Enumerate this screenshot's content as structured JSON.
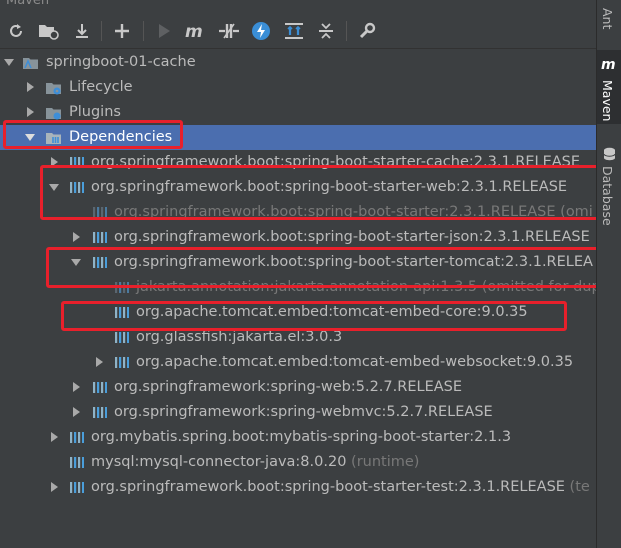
{
  "window": {
    "title": "Maven"
  },
  "toolbar": {
    "buttons": [
      {
        "name": "reload-icon"
      },
      {
        "name": "generate-sources-icon"
      },
      {
        "name": "download-icon"
      },
      {
        "name": "add-icon"
      },
      {
        "name": "run-icon"
      },
      {
        "name": "execute-goal-icon"
      },
      {
        "name": "toggle-offline-icon"
      },
      {
        "name": "skip-tests-icon"
      },
      {
        "name": "show-dependencies-icon"
      },
      {
        "name": "collapse-all-icon"
      },
      {
        "name": "settings-icon"
      }
    ]
  },
  "sidebar": {
    "tabs": [
      {
        "label": "Ant",
        "icon": "ant-icon"
      },
      {
        "label": "Maven",
        "icon": "maven-icon"
      },
      {
        "label": "Database",
        "icon": "database-icon"
      }
    ]
  },
  "tree": {
    "project": "springboot-01-cache",
    "lifecycle": "Lifecycle",
    "plugins": "Plugins",
    "dependencies": "Dependencies",
    "items": [
      {
        "text": "org.springframework.boot:spring-boot-starter-cache:2.3.1.RELEASE",
        "note": ""
      },
      {
        "text": "org.springframework.boot:spring-boot-starter-web:2.3.1.RELEASE",
        "note": ""
      },
      {
        "text": "org.springframework.boot:spring-boot-starter:2.3.1.RELEASE",
        "note": " (omi"
      },
      {
        "text": "org.springframework.boot:spring-boot-starter-json:2.3.1.RELEASE",
        "note": ""
      },
      {
        "text": "org.springframework.boot:spring-boot-starter-tomcat:2.3.1.RELEA",
        "note": ""
      },
      {
        "text": "jakarta.annotation:jakarta.annotation-api:1.3.5",
        "note": " (omitted for dup"
      },
      {
        "text": "org.apache.tomcat.embed:tomcat-embed-core:9.0.35",
        "note": ""
      },
      {
        "text": "org.glassfish:jakarta.el:3.0.3",
        "note": ""
      },
      {
        "text": "org.apache.tomcat.embed:tomcat-embed-websocket:9.0.35",
        "note": ""
      },
      {
        "text": "org.springframework:spring-web:5.2.7.RELEASE",
        "note": ""
      },
      {
        "text": "org.springframework:spring-webmvc:5.2.7.RELEASE",
        "note": ""
      },
      {
        "text": "org.mybatis.spring.boot:mybatis-spring-boot-starter:2.1.3",
        "note": ""
      },
      {
        "text": "mysql:mysql-connector-java:8.0.20",
        "note": " (runtime)"
      },
      {
        "text": "org.springframework.boot:spring-boot-starter-test:2.3.1.RELEASE",
        "note": " (te"
      }
    ]
  },
  "colors": {
    "background": "#3c3f41",
    "selection": "#4b6eaf",
    "text": "#bbbbbb",
    "dim_text": "#787878",
    "highlight_box": "#e8202b",
    "maven_blue": "#3d8ed8"
  }
}
